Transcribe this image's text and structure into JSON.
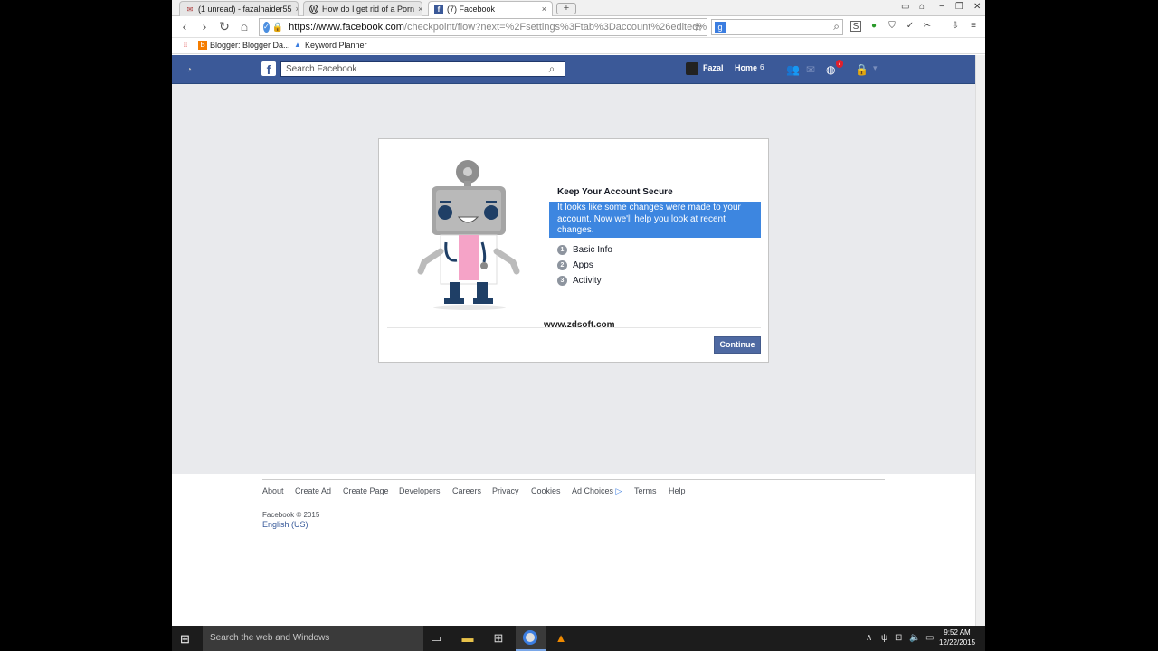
{
  "browser": {
    "tabs": [
      {
        "label": "(1 unread) - fazalhaider55",
        "icon": "mail-icon"
      },
      {
        "label": "How do I get rid of a Porn",
        "icon": "wordpress-icon"
      },
      {
        "label": "(7) Facebook",
        "icon": "facebook-icon"
      }
    ],
    "tab_close": "×",
    "new_tab": "+",
    "url_host": "https://www.facebook.com",
    "url_path": "/checkpoint/flow?next=%2Fsettings%3Ftab%3Daccount%26edited%",
    "google_letter": "g",
    "bookmarks": [
      {
        "label": "Blogger: Blogger Da..."
      },
      {
        "label": "Keyword Planner"
      }
    ]
  },
  "facebook": {
    "search_placeholder": "Search Facebook",
    "user_name": "Fazal",
    "home_label": "Home",
    "home_count": "6",
    "notification_count": "7",
    "card": {
      "title": "Keep Your Account Secure",
      "description": "It looks like some changes were made to your account. Now we'll help you look at recent changes.",
      "steps": [
        {
          "num": "1",
          "label": "Basic Info"
        },
        {
          "num": "2",
          "label": "Apps"
        },
        {
          "num": "3",
          "label": "Activity"
        }
      ],
      "continue_label": "Continue",
      "watermark": "www.zdsoft.com"
    },
    "footer": {
      "links": [
        "About",
        "Create Ad",
        "Create Page",
        "Developers",
        "Careers",
        "Privacy",
        "Cookies",
        "Ad Choices",
        "Terms",
        "Help"
      ],
      "copyright": "Facebook © 2015",
      "language": "English (US)"
    }
  },
  "taskbar": {
    "search_placeholder": "Search the web and Windows",
    "time": "9:52 AM",
    "date": "12/22/2015"
  },
  "colors": {
    "facebook_blue": "#3b5998",
    "selection_blue": "#3d86e0",
    "continue_button": "#4e69a2"
  }
}
